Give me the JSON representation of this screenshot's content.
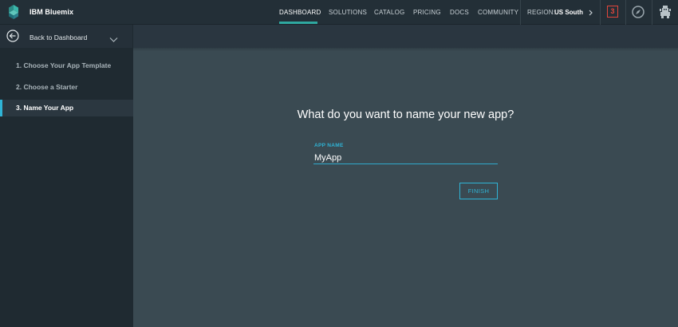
{
  "header": {
    "brand": "IBM Bluemix",
    "nav": [
      {
        "label": "DASHBOARD",
        "active": true
      },
      {
        "label": "SOLUTIONS",
        "active": false
      },
      {
        "label": "CATALOG",
        "active": false
      },
      {
        "label": "PRICING",
        "active": false
      },
      {
        "label": "DOCS",
        "active": false
      },
      {
        "label": "COMMUNITY",
        "active": false
      }
    ],
    "region_label": "REGION:",
    "region_value": "US South",
    "notification_count": "3",
    "accent_color": "#2fa8a0",
    "badge_color": "#e2463c"
  },
  "subbar": {
    "back_label": "Back to Dashboard"
  },
  "sidebar": {
    "steps": [
      {
        "label": "1. Choose Your App Template",
        "active": false
      },
      {
        "label": "2. Choose a Starter",
        "active": false
      },
      {
        "label": "3. Name Your App",
        "active": true
      }
    ]
  },
  "main": {
    "heading": "What do you want to name your new app?",
    "field_label": "APP NAME",
    "field_value": "MyApp",
    "finish_label": "FINISH",
    "accent_color": "#2fb4d6"
  }
}
